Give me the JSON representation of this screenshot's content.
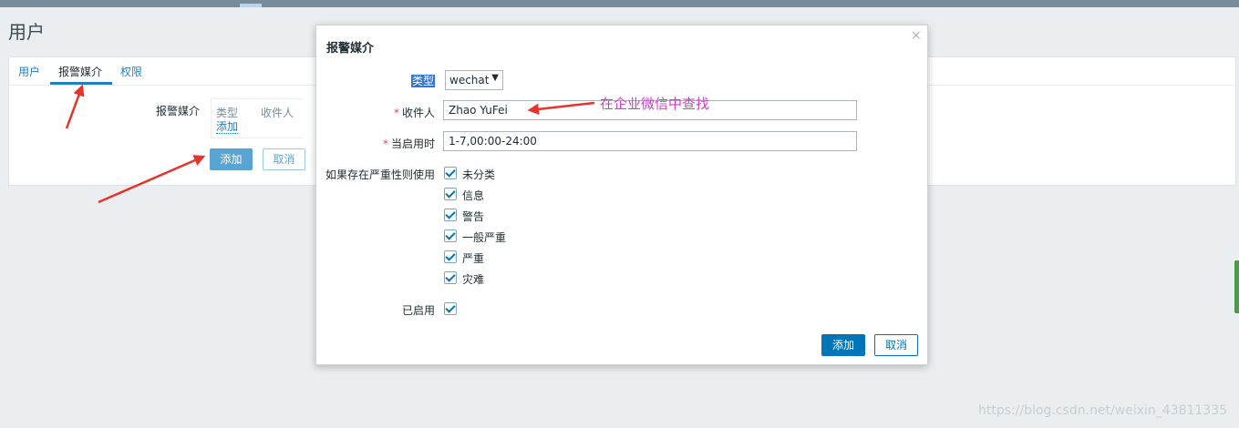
{
  "page": {
    "title": "用户"
  },
  "tabs": [
    {
      "label": "用户"
    },
    {
      "label": "报警媒介"
    },
    {
      "label": "权限"
    }
  ],
  "media": {
    "label": "报警媒介",
    "table_headers": [
      "类型",
      "收件人"
    ],
    "add_link": "添加",
    "add_button": "添加",
    "cancel_button": "取消"
  },
  "dialog": {
    "title": "报警媒介",
    "close_icon": "×",
    "type_label": "类型",
    "type_value": "wechat",
    "type_caret": "▼",
    "recipient_label": "收件人",
    "recipient_value": "Zhao YuFei",
    "when_active_label": "当启用时",
    "when_active_value": "1-7,00:00-24:00",
    "severity_label": "如果存在严重性则使用",
    "severities": [
      "未分类",
      "信息",
      "警告",
      "一般严重",
      "严重",
      "灾难"
    ],
    "enabled_label": "已启用",
    "add_button": "添加",
    "cancel_button": "取消"
  },
  "annotation": {
    "text": "在企业微信中查找"
  },
  "watermark": {
    "text": "https://blog.csdn.net/weixin_43811335"
  },
  "colors": {
    "accent": "#0275b8",
    "annotation": "#d33ad3",
    "arrow": "#e8322b"
  }
}
